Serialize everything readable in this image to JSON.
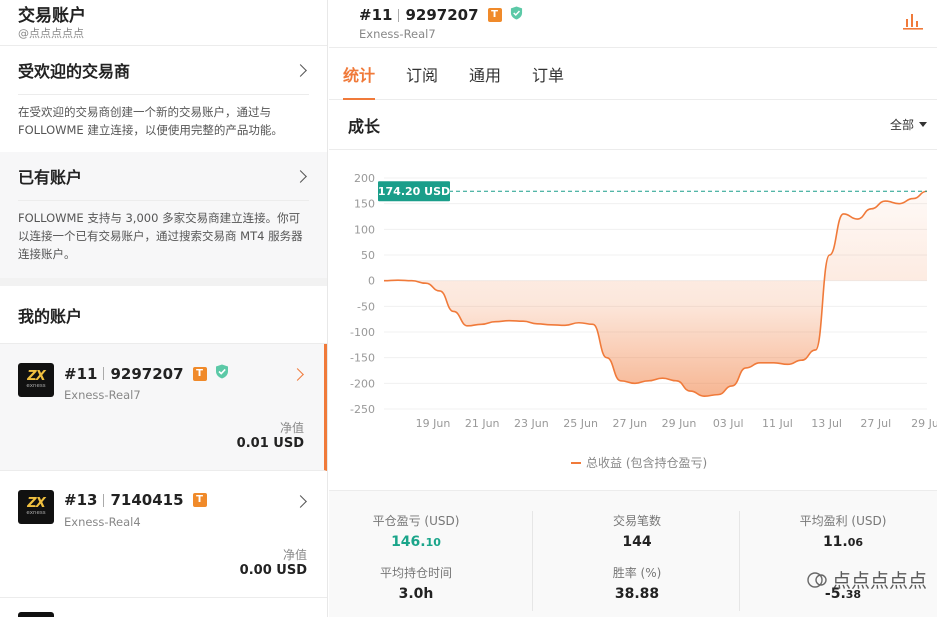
{
  "left": {
    "title": "交易账户",
    "handle": "@点点点点点",
    "popular": {
      "title": "受欢迎的交易商",
      "desc": "在受欢迎的交易商创建一个新的交易账户，通过与 FOLLOWME 建立连接，以便使用完整的产品功能。"
    },
    "existing": {
      "title": "已有账户",
      "desc": "FOLLOWME 支持与 3,000 多家交易商建立连接。你可以连接一个已有交易账户，通过搜索交易商 MT4 服务器连接账户。"
    },
    "my_accounts_title": "我的账户",
    "accounts": [
      {
        "index": "#11",
        "number": "9297207",
        "badge": "T",
        "server": "Exness-Real7",
        "net_label": "净值",
        "net_value_main": "0.01",
        "net_value_unit": " USD",
        "logo_top": "ZX",
        "logo_bottom": "exness"
      },
      {
        "index": "#13",
        "number": "7140415",
        "badge": "T",
        "server": "Exness-Real4",
        "net_label": "净值",
        "net_value_main": "0.00",
        "net_value_unit": " USD",
        "logo_top": "ZX",
        "logo_bottom": "exness"
      }
    ]
  },
  "right": {
    "index": "#11",
    "number": "9297207",
    "badge": "T",
    "server": "Exness-Real7",
    "tabs": [
      "统计",
      "订阅",
      "通用",
      "订单"
    ],
    "growth_title": "成长",
    "filter": "全部",
    "stats": {
      "closed_pl_label": "平仓盈亏 (USD)",
      "closed_pl_main": "146.",
      "closed_pl_dec": "10",
      "trades_label": "交易笔数",
      "trades_value": "144",
      "avg_profit_label": "平均盈利 (USD)",
      "avg_profit_main": "11.",
      "avg_profit_dec": "06",
      "hold_label": "平均持仓时间",
      "hold_value": "3.0h",
      "winrate_label": "胜率 (%)",
      "winrate_value": "38.88",
      "avg_loss_main": "-5.",
      "avg_loss_dec": "38"
    },
    "watermark": "点点点点点"
  },
  "colors": {
    "accent": "#f07a3a",
    "green": "#1aa58a",
    "teal": "#1a9e8a"
  },
  "chart_data": {
    "type": "area",
    "legend": "总收益 (包含持仓盈亏)",
    "ylim": [
      -250,
      200
    ],
    "yticks": [
      "200",
      "150",
      "100",
      "50",
      "0",
      "-50",
      "-100",
      "-150",
      "-200",
      "-250"
    ],
    "xticks": [
      "19 Jun",
      "21 Jun",
      "23 Jun",
      "25 Jun",
      "27 Jun",
      "29 Jun",
      "03 Jul",
      "11 Jul",
      "13 Jul",
      "27 Jul",
      "29 Ju"
    ],
    "current_label": "174.20 USD",
    "current_value": 174.2,
    "series": [
      {
        "values": [
          0,
          1,
          0,
          -5,
          -20,
          -60,
          -88,
          -85,
          -80,
          -78,
          -79,
          -84,
          -86,
          -87,
          -82,
          -85,
          -150,
          -195,
          -200,
          -195,
          -190,
          -195,
          -215,
          -225,
          -222,
          -205,
          -170,
          -160,
          -160,
          -163,
          -155,
          -135,
          50,
          130,
          120,
          140,
          155,
          150,
          160,
          174.2
        ]
      }
    ]
  }
}
